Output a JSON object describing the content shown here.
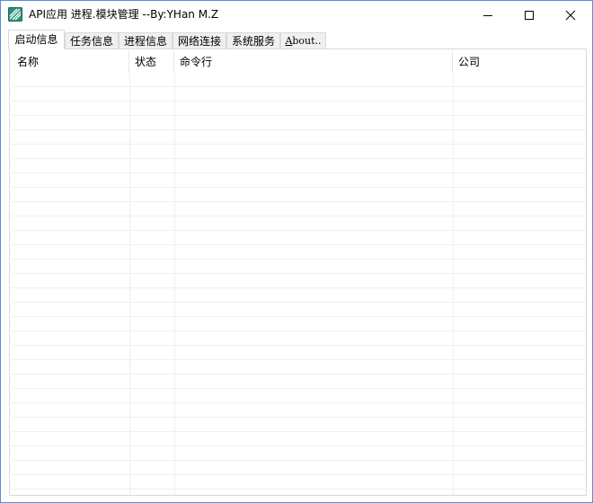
{
  "window": {
    "title": "API应用 进程.模块管理 --By:YHan M.Z"
  },
  "titlebar_buttons": {
    "minimize": "minimize",
    "maximize": "maximize",
    "close": "close"
  },
  "tabs": [
    {
      "label": "启动信息",
      "active": true
    },
    {
      "label": "任务信息",
      "active": false
    },
    {
      "label": "进程信息",
      "active": false
    },
    {
      "label": "网络连接",
      "active": false
    },
    {
      "label": "系统服务",
      "active": false
    },
    {
      "label": "About..",
      "active": false
    }
  ],
  "about_tab": {
    "accel": "A",
    "rest": "bout.."
  },
  "list": {
    "columns": [
      "名称",
      "状态",
      "命令行",
      "公司"
    ],
    "rows": []
  },
  "colors": {
    "window_border": "#5b8fd0",
    "grid_line": "#efefef",
    "tab_bg": "#f0f0f0"
  }
}
